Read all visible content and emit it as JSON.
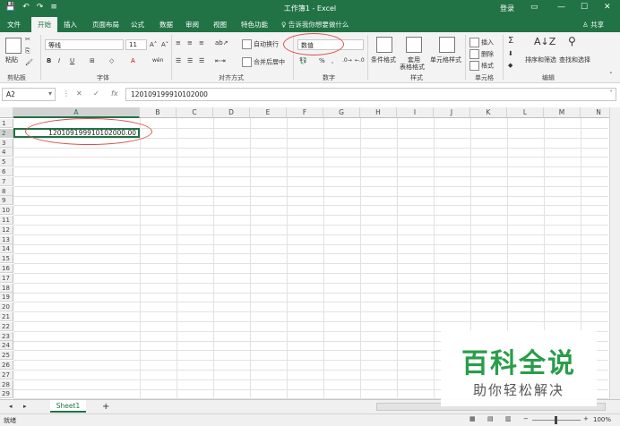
{
  "titlebar": {
    "title": "工作簿1 - Excel",
    "login": "登录",
    "quick_save": "💾",
    "quick_undo": "↶",
    "quick_redo": "↷",
    "quick_more": "≡"
  },
  "tabs": {
    "file": "文件",
    "home": "开始",
    "insert": "插入",
    "layout": "页面布局",
    "formulas": "公式",
    "data": "数据",
    "review": "审阅",
    "view": "视图",
    "features": "特色功能",
    "search": "告诉我你想要做什么",
    "share": "共享"
  },
  "ribbon": {
    "clipboard": {
      "paste": "粘贴",
      "group": "剪贴板"
    },
    "font": {
      "name": "等线",
      "size": "11",
      "group": "字体",
      "bold": "B",
      "italic": "I",
      "underline": "U",
      "grow": "A˄",
      "shrink": "A˅",
      "font_color": "A",
      "wen": "wén"
    },
    "alignment": {
      "wrap": "自动换行",
      "merge": "合并后居中",
      "group": "对齐方式"
    },
    "number": {
      "format": "数值",
      "group": "数字",
      "percent": "%",
      "comma": ","
    },
    "styles": {
      "conditional": "条件格式",
      "table_line1": "套用",
      "table_line2": "表格格式",
      "cell_styles": "单元格样式",
      "group": "样式"
    },
    "cells": {
      "insert": "插入",
      "delete": "删除",
      "format": "格式",
      "group": "单元格"
    },
    "editing": {
      "sum": "Σ",
      "sort": "排序和筛选",
      "find": "查找和选择",
      "group": "编辑"
    }
  },
  "formula_bar": {
    "name_box": "A2",
    "cancel": "✕",
    "enter": "✓",
    "fx": "fx",
    "value": "120109199910102000"
  },
  "grid": {
    "columns": [
      "A",
      "B",
      "C",
      "D",
      "E",
      "F",
      "G",
      "H",
      "I",
      "J",
      "K",
      "L",
      "M",
      "N"
    ],
    "rows": [
      "1",
      "2",
      "3",
      "4",
      "5",
      "6",
      "7",
      "8",
      "9",
      "10",
      "11",
      "12",
      "13",
      "14",
      "15",
      "16",
      "17",
      "18",
      "19",
      "20",
      "21",
      "22",
      "23",
      "24",
      "25",
      "26",
      "27",
      "28",
      "29"
    ],
    "a2_value": "120109199910102000.00"
  },
  "sheets": {
    "active": "Sheet1",
    "add": "+"
  },
  "status": {
    "ready": "就绪",
    "zoom": "100%"
  },
  "watermark": {
    "line1": "百科全说",
    "line2": "助你轻松解决"
  },
  "colors": {
    "accent": "#217346",
    "highlight_circle": "#d9534f",
    "watermark_green": "#2a9d4a"
  }
}
